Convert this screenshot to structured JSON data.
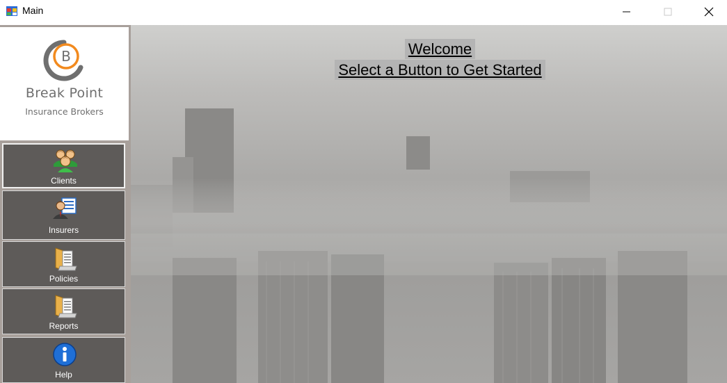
{
  "window": {
    "title": "Main",
    "icon": "windows-form-icon"
  },
  "titlebar": {
    "minimize_icon": "minimize-icon",
    "maximize_icon": "maximize-icon",
    "close_icon": "close-icon"
  },
  "logo": {
    "letter": "B",
    "title": "Break Point",
    "subtitle": "Insurance Brokers"
  },
  "nav": {
    "clients": {
      "label": "Clients",
      "icon": "users-group-icon"
    },
    "insurers": {
      "label": "Insurers",
      "icon": "person-card-icon"
    },
    "policies": {
      "label": "Policies",
      "icon": "folder-documents-icon"
    },
    "reports": {
      "label": "Reports",
      "icon": "folder-documents-icon"
    },
    "help": {
      "label": "Help",
      "icon": "info-icon"
    }
  },
  "main": {
    "welcome": "Welcome",
    "instruction": "Select a Button to Get Started"
  },
  "colors": {
    "sidebar_bg": "#a8a09b",
    "button_bg": "#5e5b59",
    "logo_orange": "#f28a1e",
    "logo_gray": "#6f6f6f"
  }
}
